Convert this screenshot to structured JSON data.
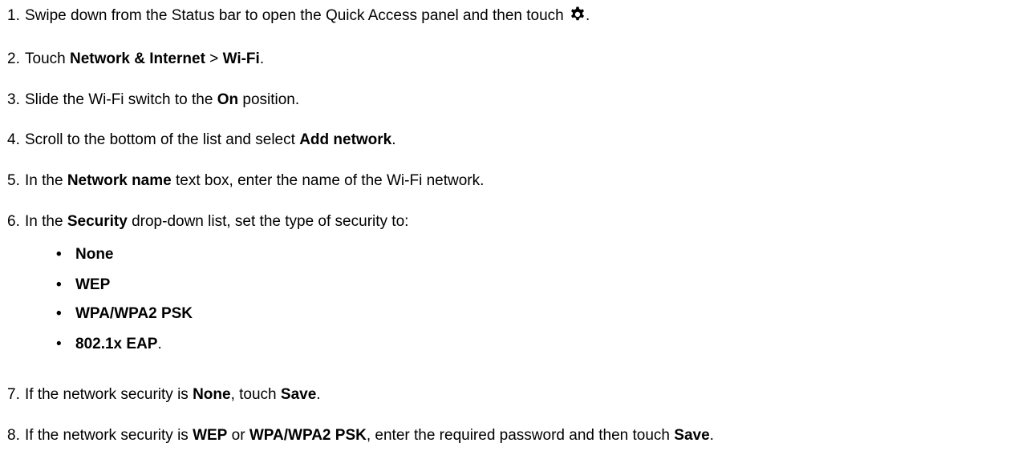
{
  "steps": [
    {
      "num": "1.",
      "t1": "Swipe down from the Status bar to open the Quick Access panel and then touch ",
      "icon": "gear-icon",
      "t2": "."
    },
    {
      "num": "2.",
      "t1": "Touch ",
      "b1": "Network & Internet",
      "t2": " > ",
      "b2": "Wi-Fi",
      "t3": "."
    },
    {
      "num": "3.",
      "t1": "Slide the Wi-Fi switch to the ",
      "b1": "On",
      "t2": " position."
    },
    {
      "num": "4.",
      "t1": "Scroll to the bottom of the list and select ",
      "b1": "Add network",
      "t2": "."
    },
    {
      "num": "5.",
      "t1": "In the ",
      "b1": "Network name",
      "t2": " text box, enter the name of the Wi-Fi network."
    },
    {
      "num": "6.",
      "t1": "In the ",
      "b1": "Security",
      "t2": " drop-down list, set the type of security to:"
    },
    {
      "num": "7.",
      "t1": "If the network security is ",
      "b1": "None",
      "t2": ", touch ",
      "b2": "Save",
      "t3": "."
    },
    {
      "num": "8.",
      "t1": "If the network security is ",
      "b1": "WEP",
      "t2": " or ",
      "b2": "WPA/WPA2 PSK",
      "t3": ", enter the required password and then touch ",
      "b3": "Save",
      "t4": "."
    }
  ],
  "security_options": [
    {
      "bullet": "•",
      "label": "None",
      "suffix": ""
    },
    {
      "bullet": "•",
      "label": "WEP",
      "suffix": ""
    },
    {
      "bullet": "•",
      "label": "WPA/WPA2 PSK",
      "suffix": ""
    },
    {
      "bullet": "•",
      "label": "802.1x EAP",
      "suffix": "."
    }
  ]
}
